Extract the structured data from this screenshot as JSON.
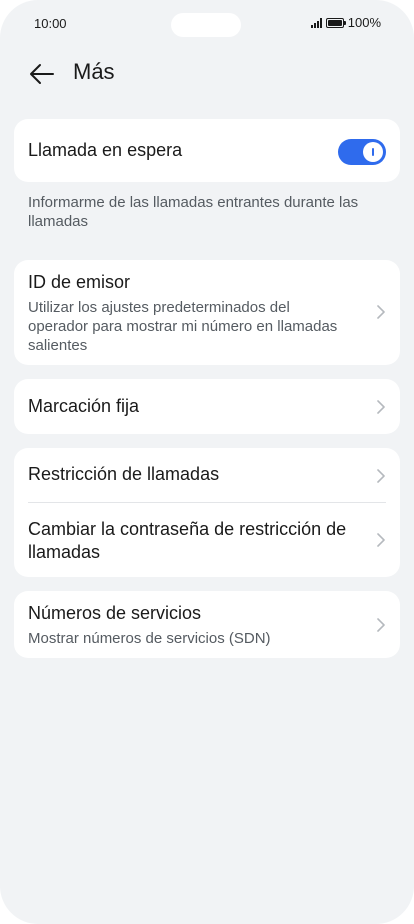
{
  "status_bar": {
    "time": "10:00",
    "battery": "100%"
  },
  "header": {
    "title": "Más"
  },
  "call_waiting": {
    "label": "Llamada en espera",
    "enabled": true,
    "note": "Informarme de las llamadas entrantes durante las llamadas"
  },
  "caller_id": {
    "label": "ID de emisor",
    "description": "Utilizar los ajustes predeterminados del operador para mostrar mi número en llamadas salientes"
  },
  "fixed_dialing": {
    "label": "Marcación fija"
  },
  "call_barring": {
    "label": "Restricción de llamadas",
    "change_password_label": "Cambiar la contraseña de restricción de llamadas"
  },
  "service_numbers": {
    "label": "Números de servicios",
    "description": "Mostrar números de servicios (SDN)"
  },
  "colors": {
    "accent": "#2f6bed",
    "background": "#f1f3f5"
  }
}
